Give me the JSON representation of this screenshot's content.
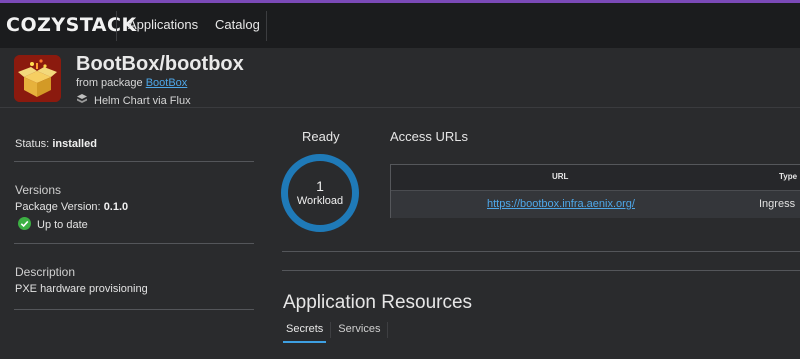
{
  "topbar": {
    "logo": "COZYSTACK",
    "nav": [
      "Applications",
      "Catalog"
    ]
  },
  "header": {
    "title": "BootBox/bootbox",
    "package_prefix": "from package",
    "package_link": "BootBox",
    "chart_source": "Helm Chart via Flux"
  },
  "summary": {
    "status_label": "Status:",
    "status_value": "installed",
    "versions_heading": "Versions",
    "package_version_label": "Package Version:",
    "package_version_value": "0.1.0",
    "up_to_date": "Up to date",
    "description_heading": "Description",
    "description_text": "PXE hardware provisioning"
  },
  "ready": {
    "label": "Ready",
    "count": "1",
    "unit": "Workload"
  },
  "access_urls": {
    "label": "Access URLs",
    "columns": [
      "URL",
      "Type"
    ],
    "rows": [
      {
        "url": "https://bootbox.infra.aenix.org/",
        "type": "Ingress"
      }
    ]
  },
  "resources": {
    "title": "Application Resources",
    "tabs": [
      "Secrets",
      "Services"
    ]
  },
  "colors": {
    "accent": "#7b4ab8",
    "link": "#4ea7e8",
    "ring": "#1f7ab8",
    "ok": "#3cb043"
  }
}
